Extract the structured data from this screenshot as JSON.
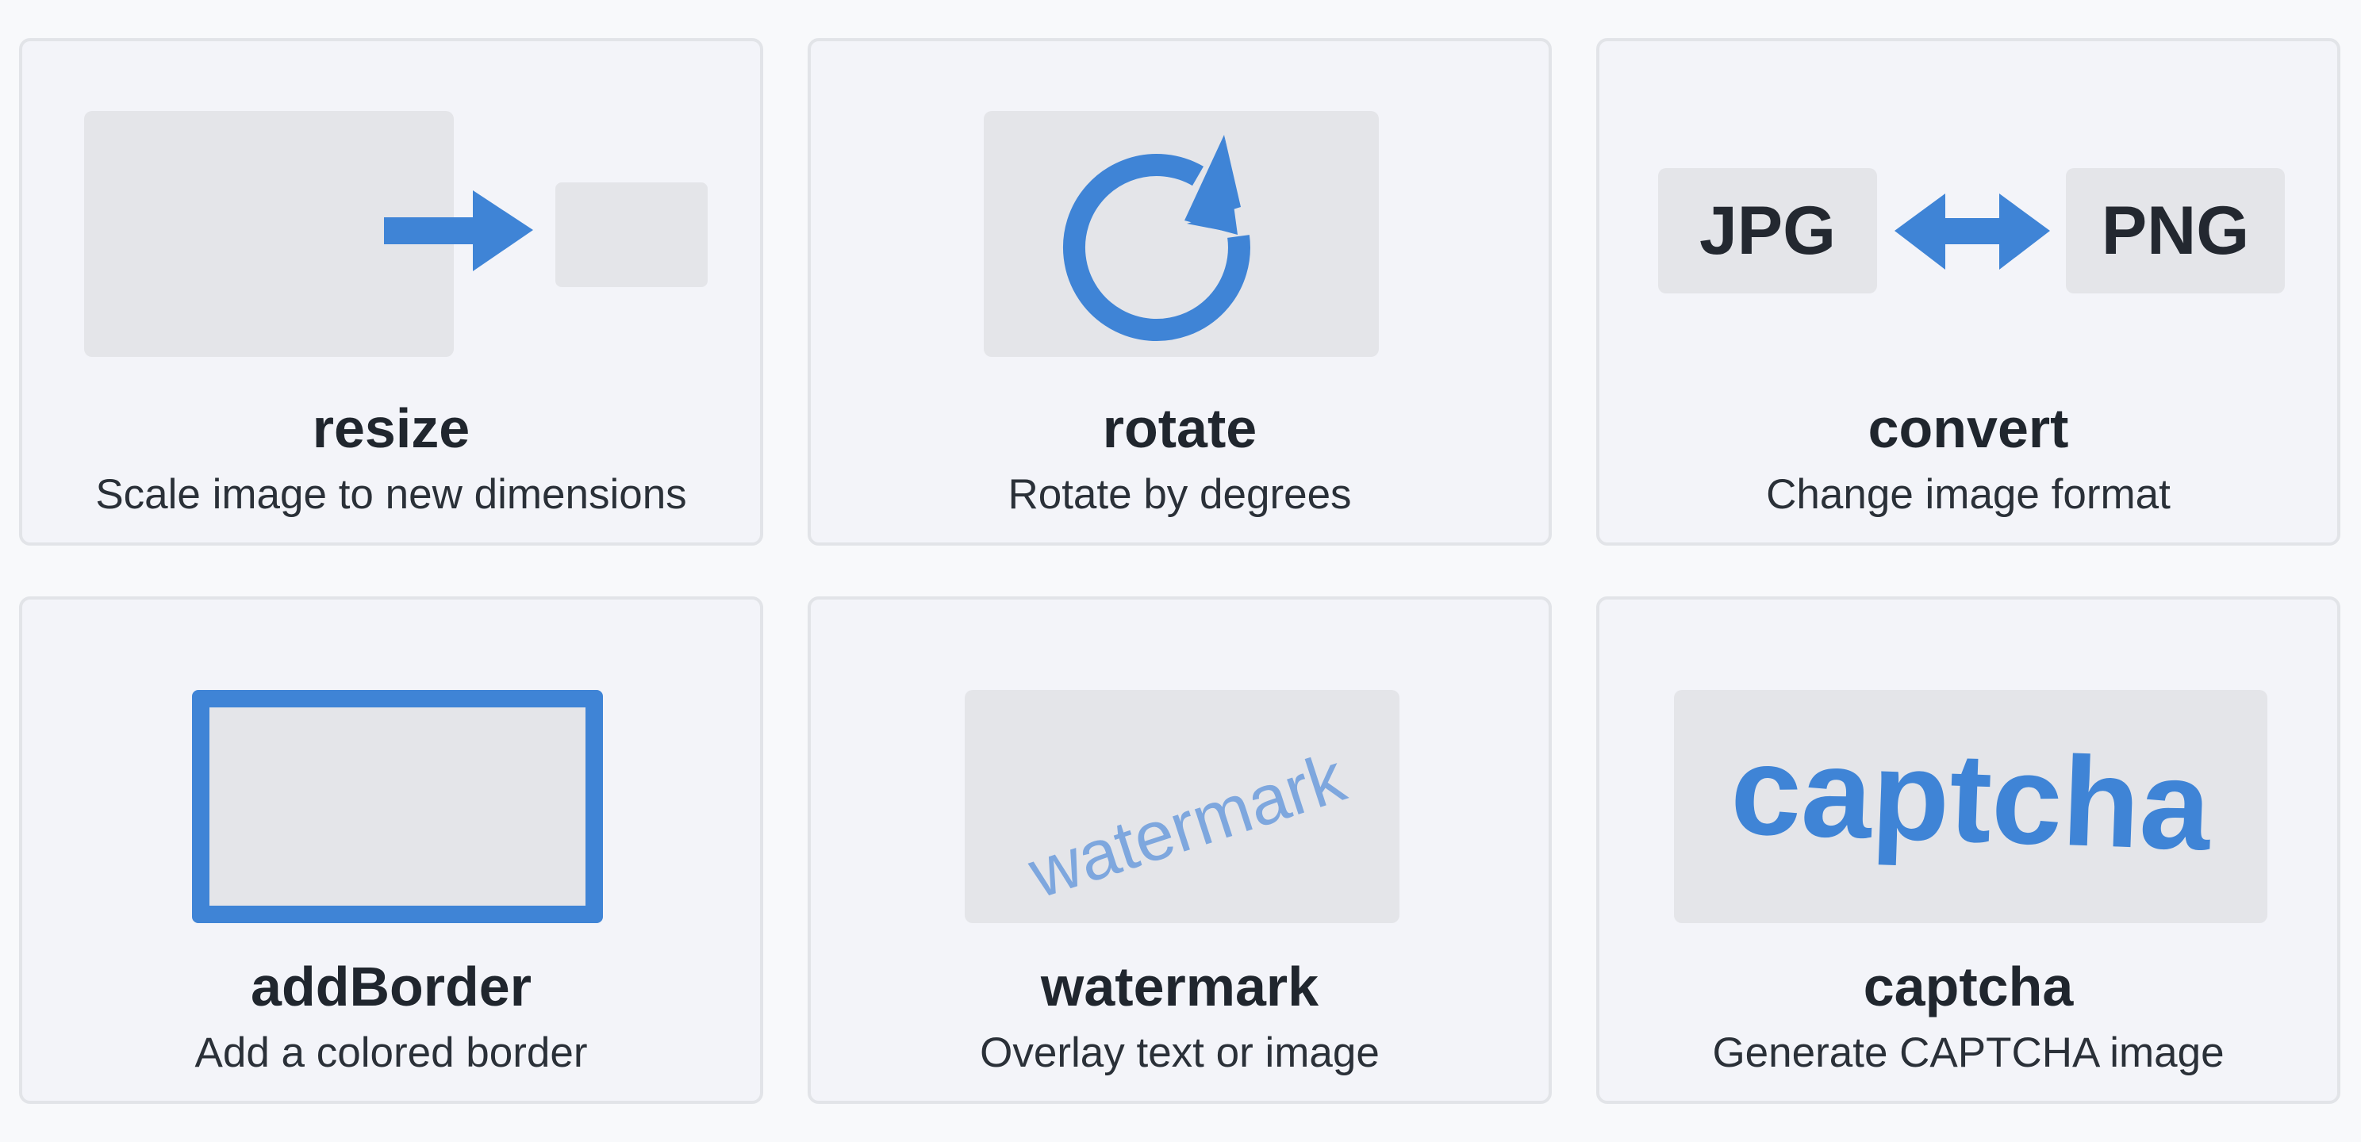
{
  "accent_color": "#3f84d6",
  "tools": [
    {
      "name": "resize",
      "description": "Scale image to new dimensions",
      "icon": "resize-arrow-icon"
    },
    {
      "name": "rotate",
      "description": "Rotate by degrees",
      "icon": "rotate-arrow-icon"
    },
    {
      "name": "convert",
      "description": "Change image format",
      "icon": "double-arrow-icon",
      "from_format": "JPG",
      "to_format": "PNG"
    },
    {
      "name": "addBorder",
      "description": "Add a colored border",
      "icon": "border-frame-icon"
    },
    {
      "name": "watermark",
      "description": "Overlay text or image",
      "icon": "watermark-text-icon",
      "sample_text": "watermark"
    },
    {
      "name": "captcha",
      "description": "Generate CAPTCHA image",
      "icon": "captcha-text-icon",
      "sample_text": "captcha"
    }
  ]
}
